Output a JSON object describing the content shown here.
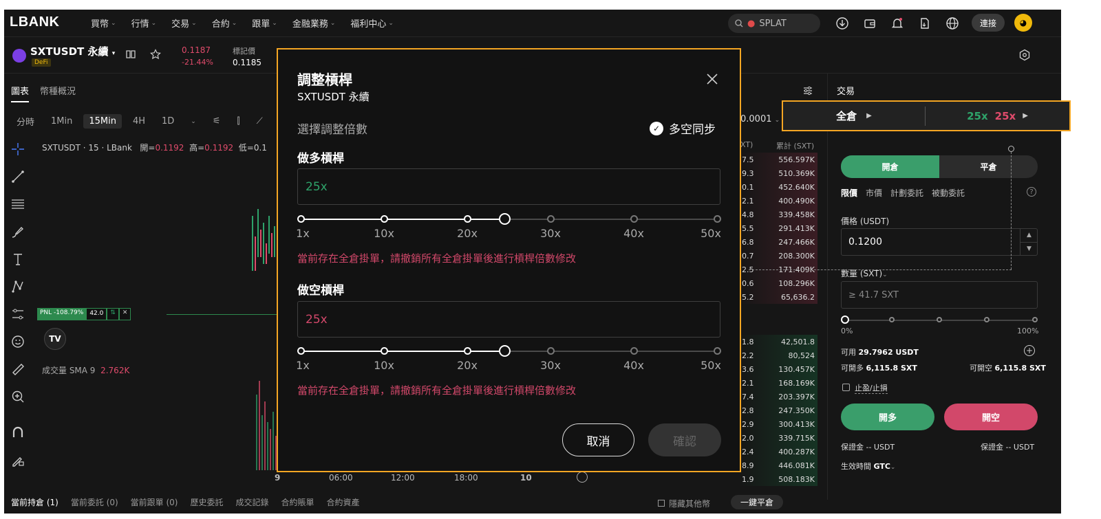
{
  "topbar": {
    "logo": "LBANK",
    "nav": [
      "買幣",
      "行情",
      "交易",
      "合約",
      "跟單",
      "金融業務",
      "福利中心"
    ],
    "search_text": "SPLAT",
    "connect_label": "連接"
  },
  "ticker": {
    "symbol": "SXTUSDT 永續",
    "tag": "DeFi",
    "last_price": "0.1187",
    "change": "-21.44%",
    "mark_label": "標記價",
    "mark_value": "0.1185"
  },
  "chart": {
    "tabs": [
      "圖表",
      "幣種概況"
    ],
    "timeframes": [
      "分時",
      "1Min",
      "15Min",
      "4H",
      "1D"
    ],
    "active_timeframe": "15Min",
    "header_title": "SXTUSDT · 15 · LBank",
    "open_label": "開=",
    "open_value": "0.1192",
    "high_label": "高=",
    "high_value": "0.1192",
    "low_label": "低=0.1",
    "pnl_label": "PNL -108.79%",
    "pnl_qty": "42.0",
    "tv_logo": "TV",
    "volume_label": "成交量 SMA 9",
    "volume_value": "2.762K",
    "x_labels": [
      "9",
      "06:00",
      "12:00",
      "18:00",
      "10"
    ]
  },
  "orderbook": {
    "step": "0.0001",
    "col_left": "XT)",
    "col_right": "累計 (SXT)",
    "asks": [
      {
        "p": "7.5",
        "t": "556.597K"
      },
      {
        "p": "9.3",
        "t": "510.369K"
      },
      {
        "p": "0.1",
        "t": "452.640K"
      },
      {
        "p": "2.1",
        "t": "400.490K"
      },
      {
        "p": "4.8",
        "t": "339.458K"
      },
      {
        "p": "5.5",
        "t": "291.413K"
      },
      {
        "p": "6.8",
        "t": "247.466K"
      },
      {
        "p": "0.7",
        "t": "208.300K"
      },
      {
        "p": "2.5",
        "t": "171.409K"
      },
      {
        "p": "0.6",
        "t": "108.296K"
      },
      {
        "p": "5.2",
        "t": "65,636.2"
      }
    ],
    "bids": [
      {
        "p": "1.8",
        "t": "42,501.8"
      },
      {
        "p": "2.2",
        "t": "80,524"
      },
      {
        "p": "3.6",
        "t": "130.457K"
      },
      {
        "p": "2.1",
        "t": "168.169K"
      },
      {
        "p": "7.4",
        "t": "203.397K"
      },
      {
        "p": "2.8",
        "t": "247.350K"
      },
      {
        "p": "2.9",
        "t": "300.413K"
      },
      {
        "p": "2.0",
        "t": "339.715K"
      },
      {
        "p": "2.4",
        "t": "400.287K"
      },
      {
        "p": "8.9",
        "t": "446.081K"
      },
      {
        "p": "1.9",
        "t": "508.183K"
      }
    ]
  },
  "trade": {
    "title": "交易",
    "margin_mode": "全倉",
    "long_lev": "25x",
    "short_lev": "25x",
    "open_tab": "開倉",
    "close_tab": "平倉",
    "order_types": [
      "限價",
      "市價",
      "計劃委託",
      "被動委託"
    ],
    "price_label": "價格 (USDT)",
    "price_value": "0.1200",
    "qty_label": "數量 (SXT)",
    "qty_placeholder": "≥ 41.7 SXT",
    "pct_min": "0%",
    "pct_max": "100%",
    "available_label": "可用",
    "available_value": "29.7962 USDT",
    "can_long_label": "可開多",
    "can_long_value": "6,115.8 SXT",
    "can_short_label": "可開空",
    "can_short_value": "6,115.8 SXT",
    "tpsl_label": "止盈/止損",
    "buy_label": "開多",
    "sell_label": "開空",
    "margin_left": "保證金 -- USDT",
    "margin_right": "保證金 -- USDT",
    "tif_label": "生效時間",
    "tif_value": "GTC"
  },
  "modal": {
    "title": "調整槓桿",
    "subtitle": "SXTUSDT 永續",
    "select_label": "選擇調整倍數",
    "sync_label": "多空同步",
    "long_label": "做多槓桿",
    "long_value": "25x",
    "short_label": "做空槓桿",
    "short_value": "25x",
    "ticks": [
      "1x",
      "10x",
      "20x",
      "30x",
      "40x",
      "50x"
    ],
    "slider_value_fraction": 0.49,
    "warning": "當前存在全倉掛單，請撤銷所有全倉掛單後進行槓桿倍數修改",
    "cancel_label": "取消",
    "confirm_label": "確認"
  },
  "bottom": {
    "tabs": [
      "當前持倉 (1)",
      "當前委託 (0)",
      "當前跟單 (0)",
      "歷史委託",
      "成交記錄",
      "合約賬單",
      "合約資產"
    ],
    "hide_label": "隱藏其他幣",
    "close_all": "一鍵平倉"
  },
  "colors": {
    "accent_green": "#2ea36a",
    "accent_red": "#d2486a",
    "highlight_border": "#f5a623"
  }
}
